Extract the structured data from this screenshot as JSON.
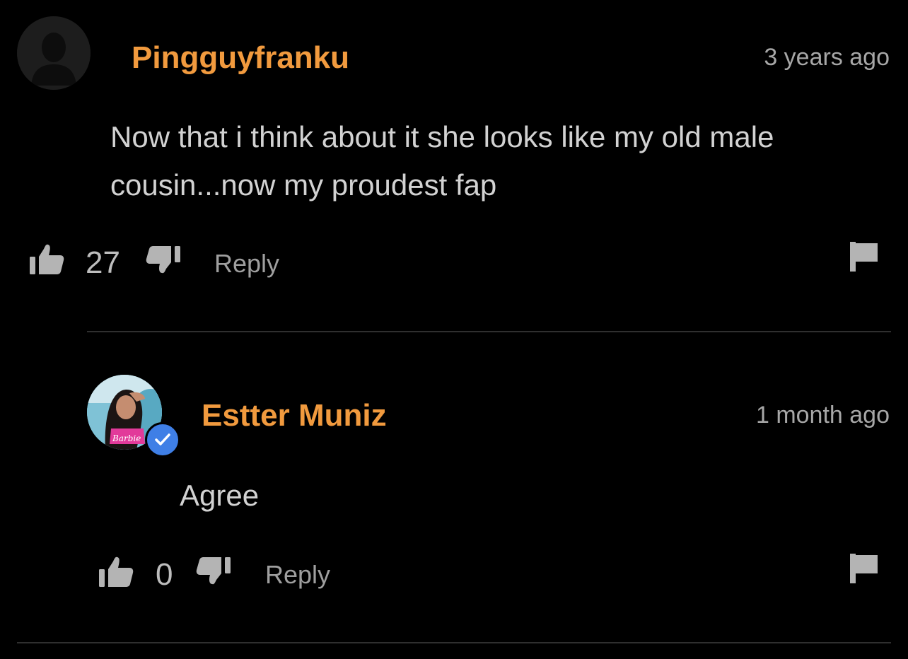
{
  "comments": [
    {
      "username": "Pingguyfranku",
      "timestamp": "3 years ago",
      "text": "Now that i think about it she looks like my old male cousin...now my proudest fap",
      "likes": "27",
      "reply_label": "Reply",
      "avatar": "default-avatar-silhouette"
    },
    {
      "username": "Estter Muniz",
      "timestamp": "1 month ago",
      "text": "Agree",
      "likes": "0",
      "reply_label": "Reply",
      "avatar": "user-photo",
      "verified": true,
      "avatar_badge_text": "Barbie"
    }
  ],
  "colors": {
    "background": "#000000",
    "username": "#f19a3e",
    "text": "#d2d2d2",
    "muted": "#a7a7a7",
    "verified": "#3f7fe6",
    "divider": "#2f2f2f"
  },
  "icons": [
    "thumbs-up-icon",
    "thumbs-down-icon",
    "flag-icon",
    "verified-check-icon"
  ]
}
